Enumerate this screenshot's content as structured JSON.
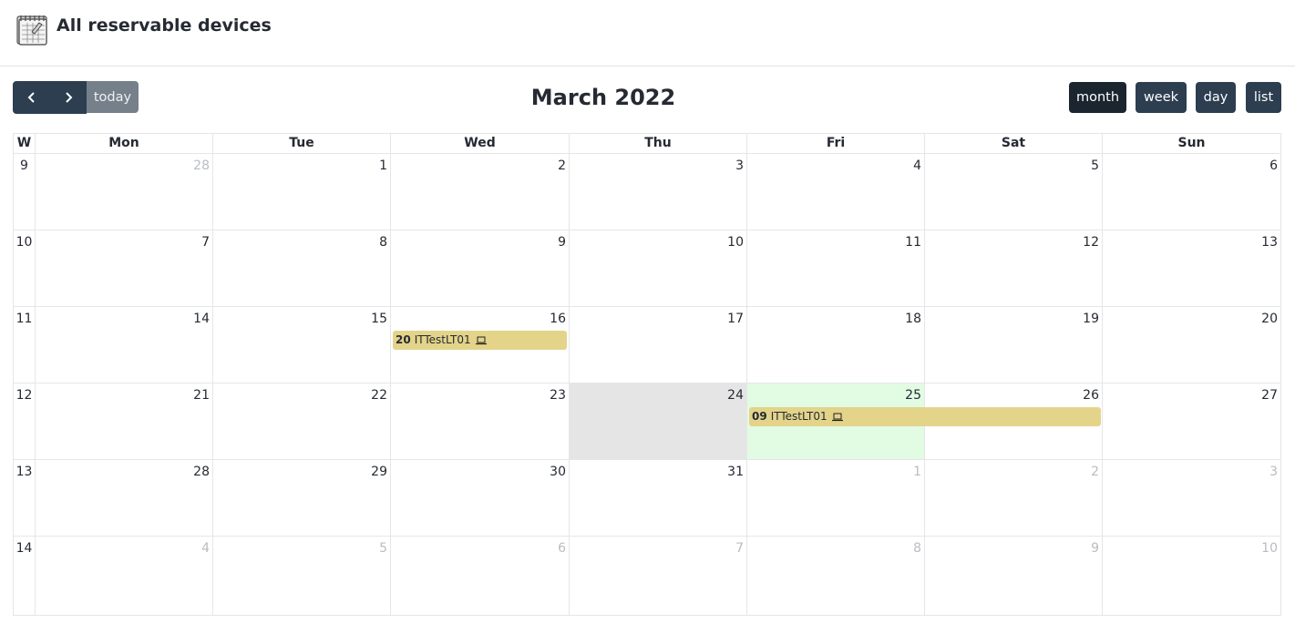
{
  "header": {
    "title": "All reservable devices",
    "icon": "calendar-notebook-icon"
  },
  "toolbar": {
    "title": "March 2022",
    "prev_icon": "chevron-left-icon",
    "next_icon": "chevron-right-icon",
    "today_label": "today",
    "views": [
      {
        "label": "month",
        "active": true
      },
      {
        "label": "week",
        "active": false
      },
      {
        "label": "day",
        "active": false
      },
      {
        "label": "list",
        "active": false
      }
    ]
  },
  "calendar": {
    "week_col_header": "W",
    "day_headers": [
      "Mon",
      "Tue",
      "Wed",
      "Thu",
      "Fri",
      "Sat",
      "Sun"
    ],
    "weeks": [
      {
        "week": "9",
        "days": [
          "28",
          "1",
          "2",
          "3",
          "4",
          "5",
          "6"
        ]
      },
      {
        "week": "10",
        "days": [
          "7",
          "8",
          "9",
          "10",
          "11",
          "12",
          "13"
        ]
      },
      {
        "week": "11",
        "days": [
          "14",
          "15",
          "16",
          "17",
          "18",
          "19",
          "20"
        ]
      },
      {
        "week": "12",
        "days": [
          "21",
          "22",
          "23",
          "24",
          "25",
          "26",
          "27"
        ]
      },
      {
        "week": "13",
        "days": [
          "28",
          "29",
          "30",
          "31",
          "1",
          "2",
          "3"
        ]
      },
      {
        "week": "14",
        "days": [
          "4",
          "5",
          "6",
          "7",
          "8",
          "9",
          "10"
        ]
      }
    ],
    "events": [
      {
        "time": "20",
        "title": "ITTestLT01",
        "icon": "laptop-icon"
      },
      {
        "time": "09",
        "title": "ITTestLT01",
        "icon": "laptop-icon"
      }
    ]
  }
}
